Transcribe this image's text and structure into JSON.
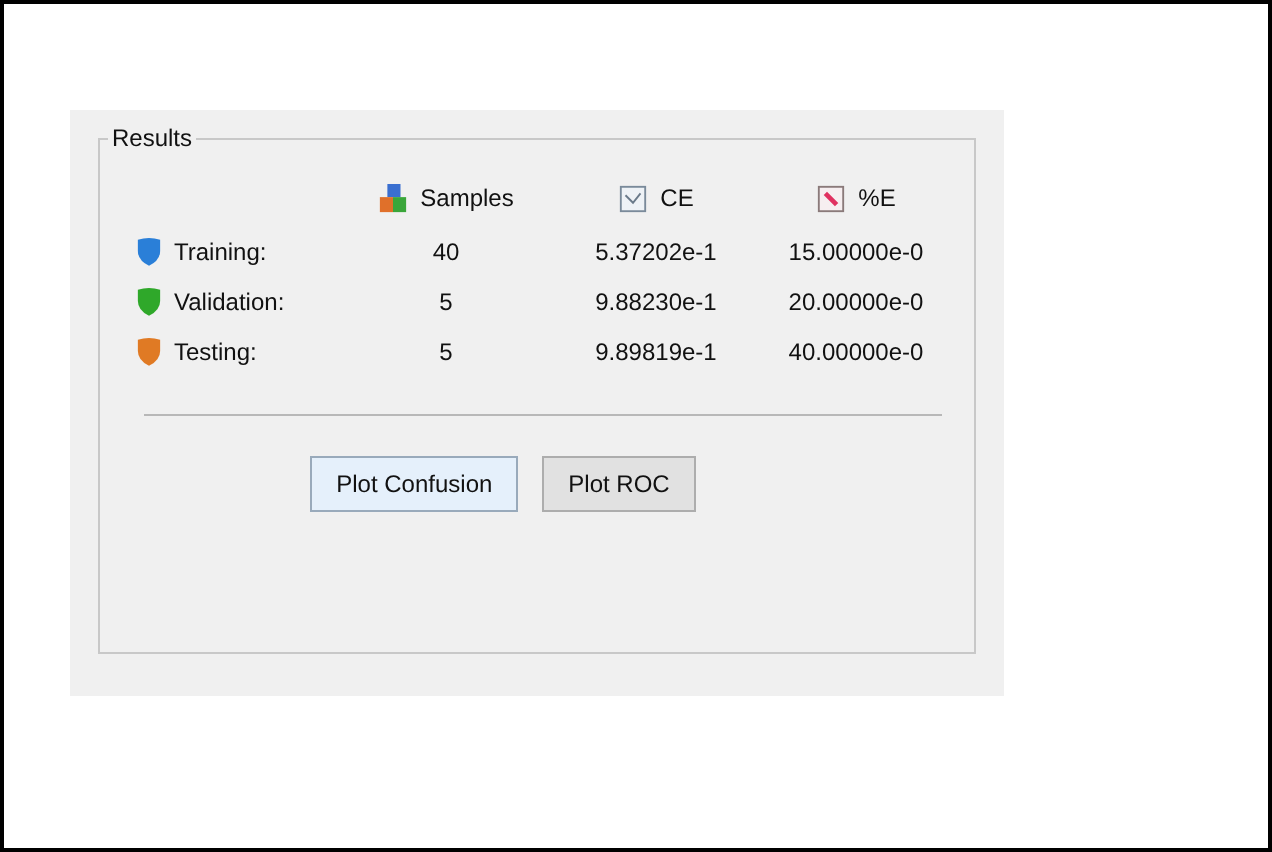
{
  "results": {
    "title": "Results",
    "columns": [
      {
        "label": "Samples",
        "kind": "samples"
      },
      {
        "label": "CE",
        "kind": "ce"
      },
      {
        "label": "%E",
        "kind": "pe"
      }
    ],
    "rows": [
      {
        "label": "Training:",
        "color": "#2a7fd8",
        "samples": "40",
        "ce": "5.37202e-1",
        "pe": "15.00000e-0"
      },
      {
        "label": "Validation:",
        "color": "#2fa82a",
        "samples": "5",
        "ce": "9.88230e-1",
        "pe": "20.00000e-0"
      },
      {
        "label": "Testing:",
        "color": "#e07a24",
        "samples": "5",
        "ce": "9.89819e-1",
        "pe": "40.00000e-0"
      }
    ],
    "buttons": [
      "Plot Confusion",
      "Plot ROC"
    ]
  }
}
